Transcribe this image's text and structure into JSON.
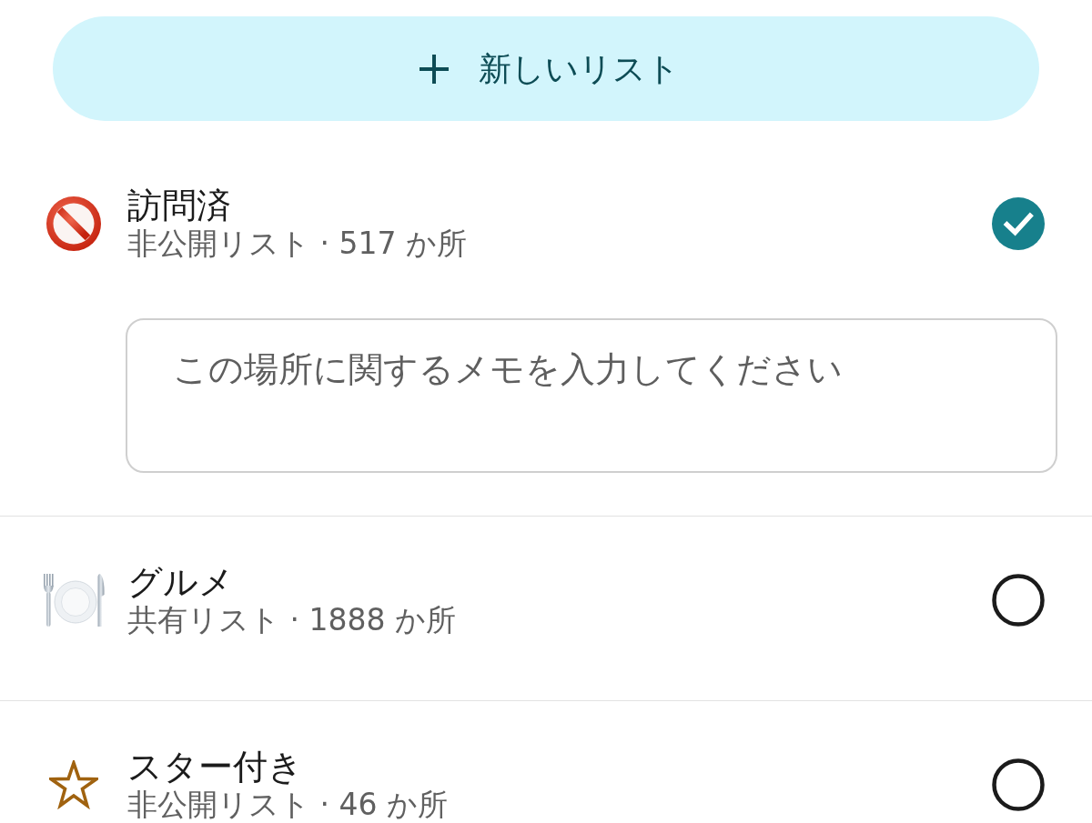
{
  "new_list_button": {
    "label": "新しいリスト"
  },
  "lists": [
    {
      "kind": "visited",
      "title": "訪問済",
      "subtitle": "非公開リスト · 517 か所",
      "selected": true,
      "memo": {
        "placeholder": "この場所に関するメモを入力してください"
      }
    },
    {
      "kind": "dining",
      "title": "グルメ",
      "subtitle": "共有リスト · 1888 か所",
      "selected": false
    },
    {
      "kind": "starred",
      "title": "スター付き",
      "subtitle": "非公開リスト · 46 か所",
      "selected": false
    }
  ]
}
